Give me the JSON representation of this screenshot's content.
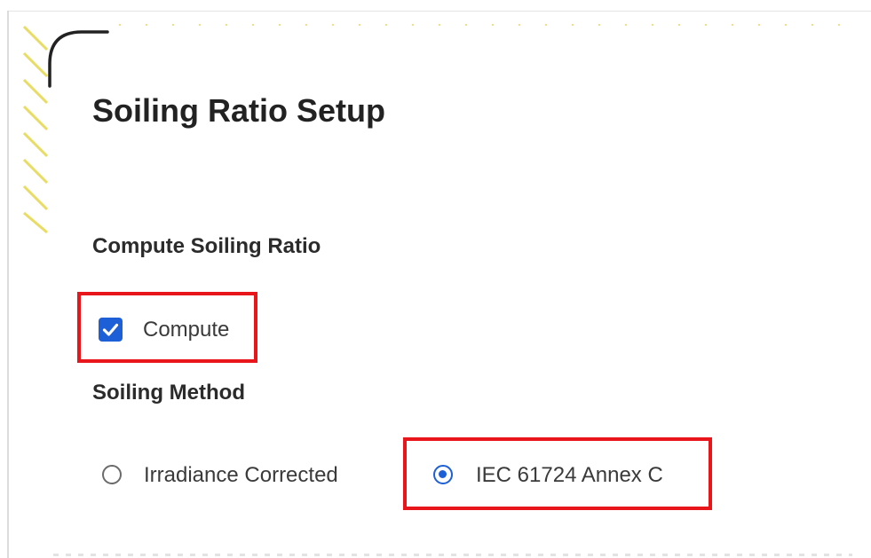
{
  "page": {
    "title": "Soiling Ratio Setup"
  },
  "compute_section": {
    "heading": "Compute Soiling Ratio",
    "checkbox_label": "Compute",
    "checkbox_checked": true
  },
  "method_section": {
    "heading": "Soiling Method",
    "options": [
      {
        "label": "Irradiance Corrected",
        "selected": false
      },
      {
        "label": "IEC 61724 Annex C",
        "selected": true
      }
    ]
  },
  "icons": {
    "checkbox": "checkmark-icon",
    "corner": "corner-arc-decoration"
  },
  "colors": {
    "accent": "#1d5fd6",
    "highlight": "#e8151b",
    "stripes": "#e8dc62",
    "text": "#222222"
  }
}
